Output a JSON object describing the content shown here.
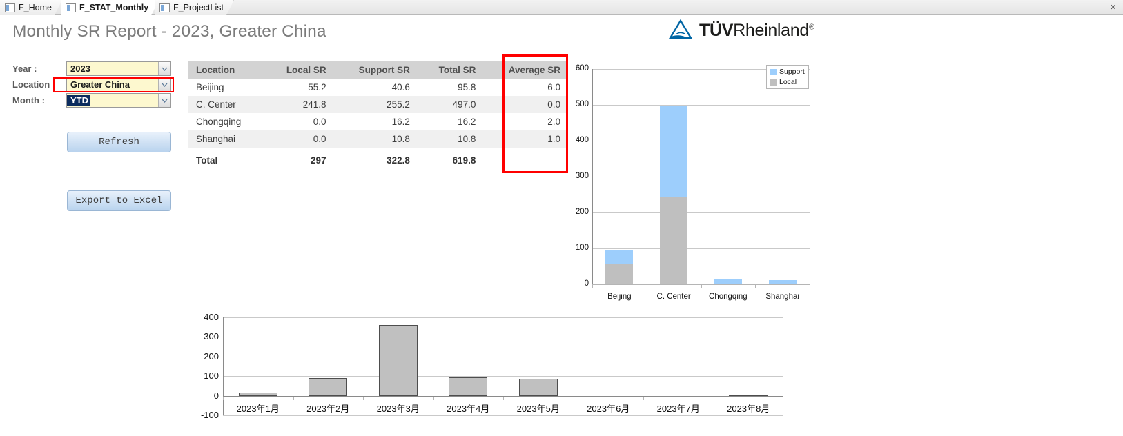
{
  "window": {
    "close_label": "×"
  },
  "tabs": [
    {
      "label": "F_Home",
      "active": false,
      "icon": "form-icon"
    },
    {
      "label": "F_STAT_Monthly",
      "active": true,
      "icon": "form-icon"
    },
    {
      "label": "F_ProjectList",
      "active": false,
      "icon": "form-icon"
    }
  ],
  "header": {
    "title": "Monthly SR Report - 2023, Greater China",
    "logo_bold": "TÜV",
    "logo_rest": "Rheinland",
    "logo_reg": "®",
    "logo_color": "#0065a4"
  },
  "filters": {
    "year": {
      "label": "Year :",
      "value": "2023"
    },
    "location": {
      "label": "Location :",
      "value": "Greater China",
      "highlight_color": "#ff0000"
    },
    "month": {
      "label": "Month :",
      "value": "YTD",
      "selected": true
    }
  },
  "buttons": {
    "refresh": "Refresh",
    "export": "Export to Excel"
  },
  "table": {
    "columns": [
      "Location",
      "Local SR",
      "Support SR",
      "Total SR",
      "Average SR"
    ],
    "rows": [
      {
        "location": "Beijing",
        "local": "55.2",
        "support": "40.6",
        "total": "95.8",
        "average": "6.0"
      },
      {
        "location": "C. Center",
        "local": "241.8",
        "support": "255.2",
        "total": "497.0",
        "average": "0.0"
      },
      {
        "location": "Chongqing",
        "local": "0.0",
        "support": "16.2",
        "total": "16.2",
        "average": "2.0"
      },
      {
        "location": "Shanghai",
        "local": "0.0",
        "support": "10.8",
        "total": "10.8",
        "average": "1.0"
      }
    ],
    "total_row": {
      "location": "Total",
      "local": "297",
      "support": "322.8",
      "total": "619.8",
      "average": ""
    },
    "highlight_column": "Average SR",
    "highlight_color": "#ff0000"
  },
  "chart_data": [
    {
      "id": "location-stacked-bar",
      "type": "bar",
      "stacked": true,
      "title": "",
      "categories": [
        "Beijing",
        "C. Center",
        "Chongqing",
        "Shanghai"
      ],
      "series": [
        {
          "name": "Local",
          "values": [
            55.2,
            241.8,
            0.0,
            0.0
          ],
          "color": "#bfbfbf"
        },
        {
          "name": "Support",
          "values": [
            40.6,
            255.2,
            16.2,
            10.8
          ],
          "color": "#9dcefc"
        }
      ],
      "yticks": [
        0,
        100,
        200,
        300,
        400,
        500,
        600
      ],
      "ylim": [
        0,
        600
      ],
      "xlabel": "",
      "ylabel": "",
      "grid": true,
      "legend_position": "top-right",
      "legend_order": [
        "Support",
        "Local"
      ]
    },
    {
      "id": "monthly-bar",
      "type": "bar",
      "stacked": false,
      "title": "",
      "categories": [
        "2023年1月",
        "2023年2月",
        "2023年3月",
        "2023年4月",
        "2023年5月",
        "2023年6月",
        "2023年7月",
        "2023年8月"
      ],
      "values": [
        16,
        90,
        363,
        93,
        88,
        0,
        0,
        5
      ],
      "color": "#c0c0c0",
      "yticks": [
        -100,
        0,
        100,
        200,
        300,
        400
      ],
      "ylim": [
        -100,
        400
      ],
      "xlabel": "",
      "ylabel": "",
      "grid": true,
      "legend_position": "none"
    }
  ]
}
